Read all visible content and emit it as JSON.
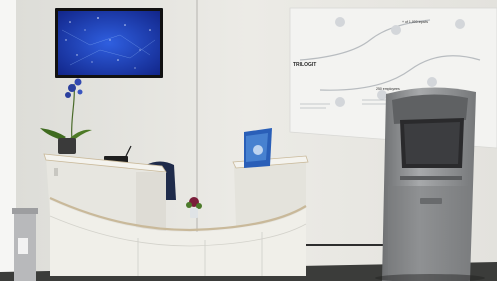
{
  "scene": {
    "poster": {
      "brand": "TRILOGIT",
      "text_1": "+ of 1,000 inputs",
      "text_2": "250 employees"
    }
  },
  "colors": {
    "wall": "#e9e8e3",
    "floor": "#3b3c3a",
    "desk": "#f1f0ea",
    "desk_edge": "#c9b99a",
    "kiosk": "#8e9092",
    "screen": "#1a3fa8"
  }
}
